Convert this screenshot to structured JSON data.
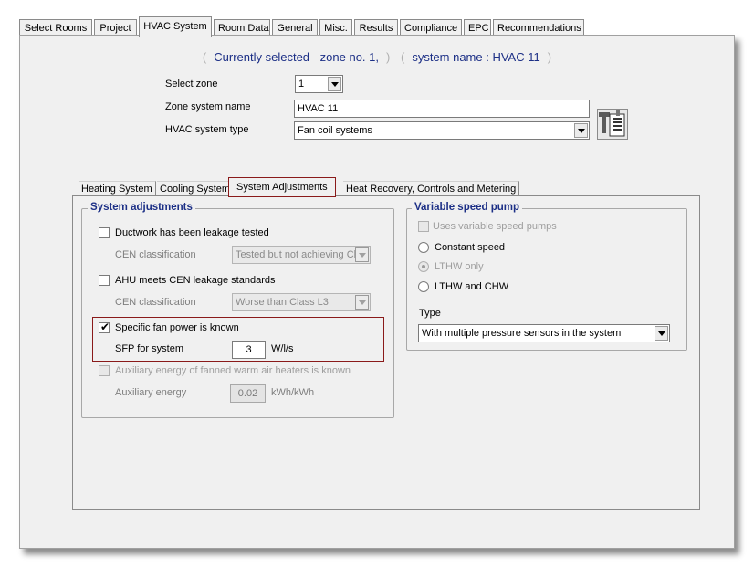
{
  "top_tabs": [
    {
      "label": "Select Rooms"
    },
    {
      "label": "Project"
    },
    {
      "label": "HVAC System"
    },
    {
      "label": "Room Data"
    },
    {
      "label": "General"
    },
    {
      "label": "Misc."
    },
    {
      "label": "Results"
    },
    {
      "label": "Compliance"
    },
    {
      "label": "EPC"
    },
    {
      "label": "Recommendations"
    }
  ],
  "header": {
    "prefix": "Currently selected",
    "zone_text": "zone no. 1,",
    "system_text": "system name : HVAC 11"
  },
  "form": {
    "select_zone_label": "Select zone",
    "select_zone_value": "1",
    "zone_system_name_label": "Zone system name",
    "zone_system_name_value": "HVAC 11",
    "hvac_type_label": "HVAC system type",
    "hvac_type_value": "Fan coil systems"
  },
  "inner_tabs": [
    {
      "label": "Heating System"
    },
    {
      "label": "Cooling System"
    },
    {
      "label": "System Adjustments"
    },
    {
      "label": "Heat Recovery, Controls and Metering"
    }
  ],
  "system_adjustments": {
    "title": "System adjustments",
    "ductwork_label": "Ductwork has been leakage tested",
    "ductwork_checked": false,
    "cen1_label": "CEN classification",
    "cen1_value": "Tested but not achieving Cl",
    "ahu_label": "AHU meets CEN leakage standards",
    "ahu_checked": false,
    "cen2_label": "CEN classification",
    "cen2_value": "Worse than Class L3",
    "sfp_known_label": "Specific fan power is known",
    "sfp_known_checked": true,
    "check_mark": "✔",
    "sfp_label": "SFP for system",
    "sfp_value": "3",
    "sfp_unit": "W/l/s",
    "aux_known_label": "Auxiliary energy of fanned warm air heaters is known",
    "aux_known_checked": false,
    "aux_label": "Auxiliary energy",
    "aux_value": "0.02",
    "aux_unit": "kWh/kWh"
  },
  "variable_speed_pump": {
    "title": "Variable speed pump",
    "uses_vsp_label": "Uses variable speed pumps",
    "constant_speed_label": "Constant speed",
    "lthw_only_label": "LTHW only",
    "lthw_chw_label": "LTHW and CHW",
    "type_label": "Type",
    "type_value": "With multiple pressure sensors in the system"
  }
}
